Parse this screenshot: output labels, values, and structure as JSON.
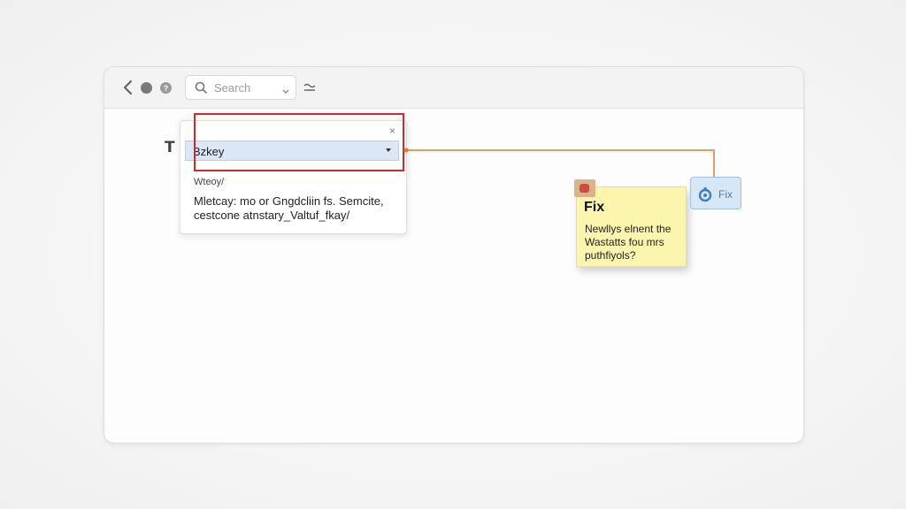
{
  "toolbar": {
    "search_placeholder": "Search"
  },
  "content": {
    "heading_glyph": "T"
  },
  "popup": {
    "close_glyph": "×",
    "select_value": "Bzkey",
    "small_label": "Wteoy/",
    "description": "Mletcay: mo or Gngdcliin fs. Semcite, cestcone atnstary_Valtuf_fkay/"
  },
  "note": {
    "title": "Fix",
    "body": "Newllys elnent the Wastatts fou mrs puthfiyols?"
  },
  "fix_button": {
    "label": "Fix"
  },
  "colors": {
    "highlight": "#d9262b",
    "connector": "#e07b2e",
    "note_bg": "#fbf5ae",
    "fix_button_bg": "#d6e8f6",
    "select_bg": "#dbe7f7"
  },
  "icons": [
    "back-icon",
    "record-icon",
    "help-icon",
    "search-icon",
    "chevron-down-icon",
    "filter-icon",
    "close-icon",
    "pin-icon",
    "fix-icon"
  ]
}
